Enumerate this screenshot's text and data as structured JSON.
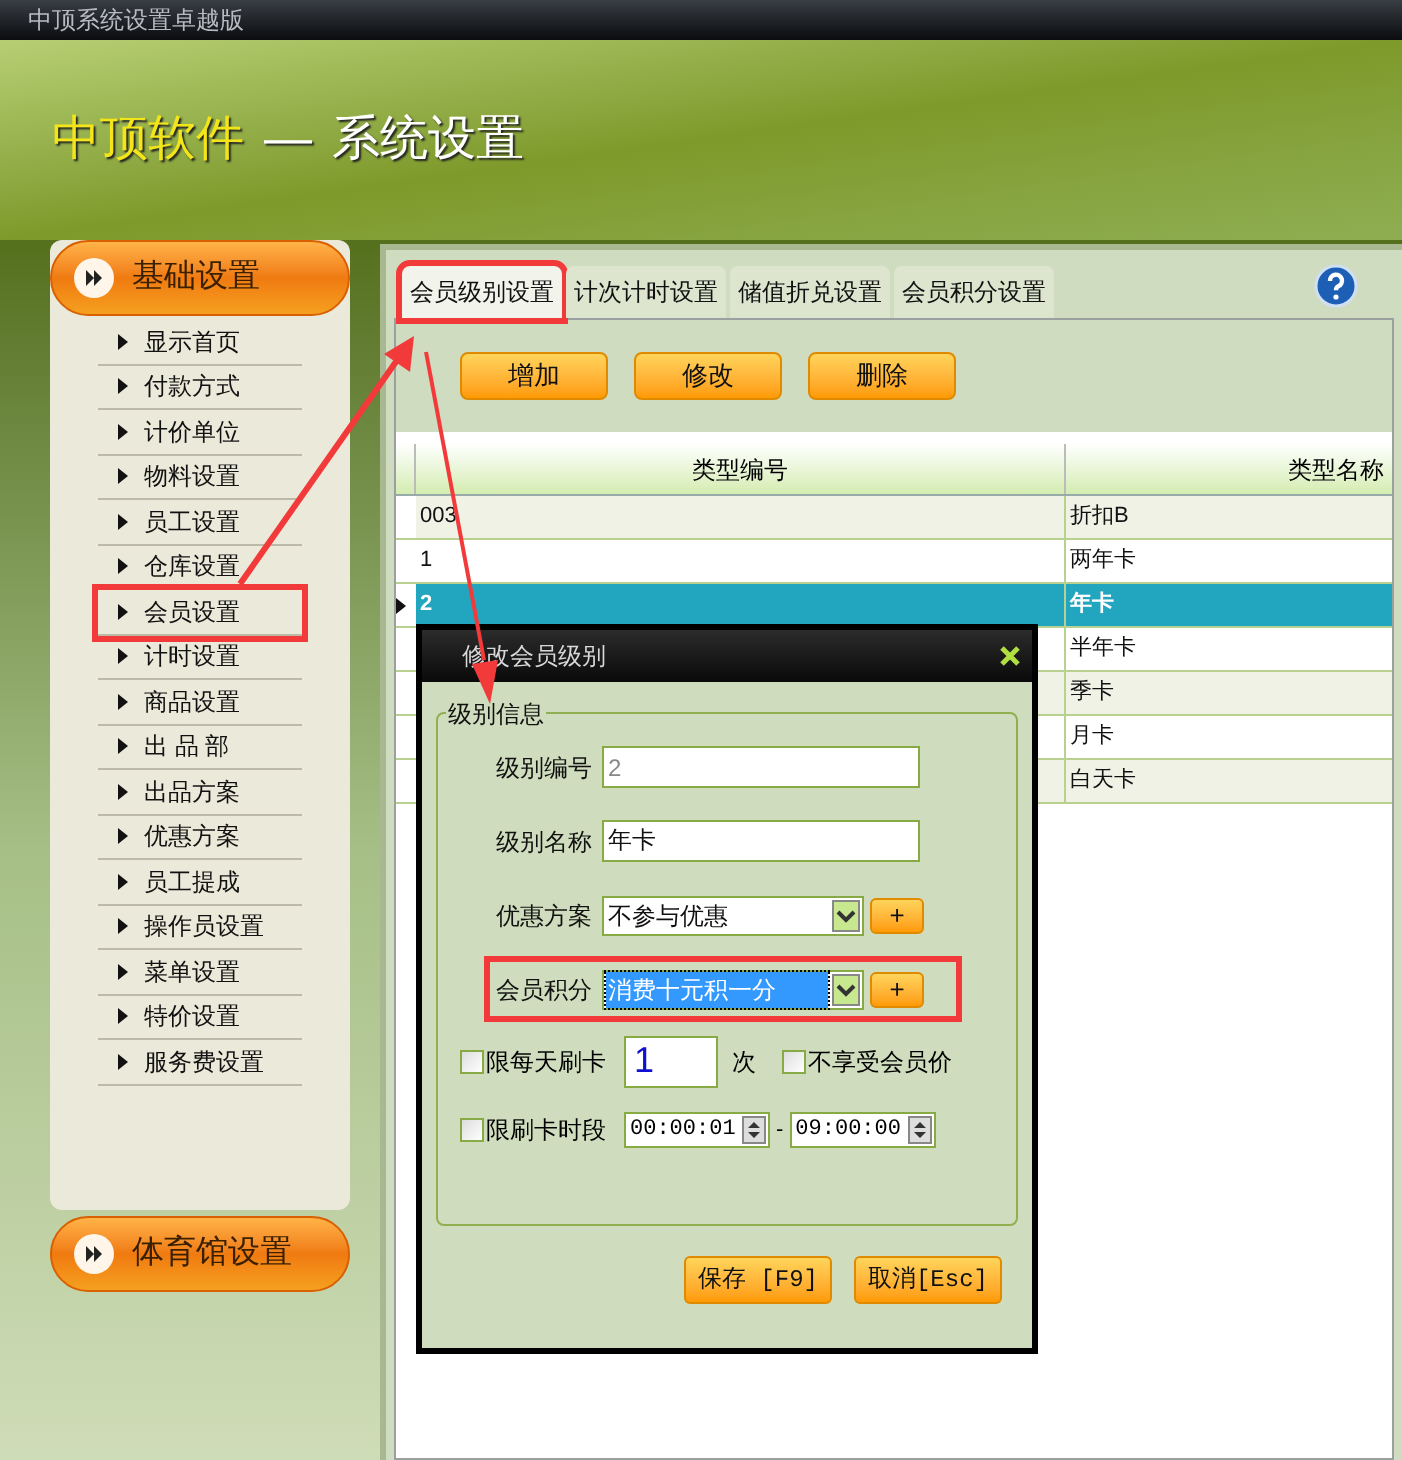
{
  "window": {
    "title": "中顶系统设置卓越版"
  },
  "banner": {
    "brand": "中顶软件",
    "separator": "—",
    "title": "系统设置"
  },
  "sidebar": {
    "header": "基础设置",
    "items": [
      {
        "label": "显示首页",
        "annotated": false
      },
      {
        "label": "付款方式",
        "annotated": false
      },
      {
        "label": "计价单位",
        "annotated": false
      },
      {
        "label": "物料设置",
        "annotated": false
      },
      {
        "label": "员工设置",
        "annotated": false
      },
      {
        "label": "仓库设置",
        "annotated": false
      },
      {
        "label": "会员设置",
        "annotated": true
      },
      {
        "label": "计时设置",
        "annotated": false
      },
      {
        "label": "商品设置",
        "annotated": false
      },
      {
        "label": "出 品 部",
        "annotated": false
      },
      {
        "label": "出品方案",
        "annotated": false
      },
      {
        "label": "优惠方案",
        "annotated": false
      },
      {
        "label": "员工提成",
        "annotated": false
      },
      {
        "label": "操作员设置",
        "annotated": false
      },
      {
        "label": "菜单设置",
        "annotated": false
      },
      {
        "label": "特价设置",
        "annotated": false
      },
      {
        "label": "服务费设置",
        "annotated": false
      }
    ],
    "footer": "体育馆设置"
  },
  "tabs": [
    {
      "label": "会员级别设置",
      "selected": true,
      "annotated": true
    },
    {
      "label": "计次计时设置",
      "selected": false,
      "annotated": false
    },
    {
      "label": "储值折兑设置",
      "selected": false,
      "annotated": false
    },
    {
      "label": "会员积分设置",
      "selected": false,
      "annotated": false
    }
  ],
  "toolbar": [
    "增加",
    "修改",
    "删除"
  ],
  "table": {
    "columns": [
      "类型编号",
      "类型名称"
    ],
    "rows": [
      {
        "code": "003",
        "name": "折扣B",
        "selected": false
      },
      {
        "code": "1",
        "name": "两年卡",
        "selected": false
      },
      {
        "code": "2",
        "name": "年卡",
        "selected": true
      },
      {
        "name": "半年卡",
        "selected": false
      },
      {
        "name": "季卡",
        "selected": false
      },
      {
        "name": "月卡",
        "selected": false
      },
      {
        "name": "白天卡",
        "selected": false
      }
    ]
  },
  "dialog": {
    "title": "修改会员级别",
    "group": "级别信息",
    "fields": [
      {
        "kind": "text",
        "label": "级别编号",
        "value": "2",
        "disabled": true
      },
      {
        "kind": "text",
        "label": "级别名称",
        "value": "年卡",
        "disabled": false
      },
      {
        "kind": "combo",
        "label": "优惠方案",
        "value": "不参与优惠",
        "add": "+",
        "focused": false
      },
      {
        "kind": "combo",
        "label": "会员积分",
        "value": "消费十元积一分",
        "add": "+",
        "focused": true,
        "annotated": true
      }
    ],
    "daily_limit": {
      "label": "限每天刷卡",
      "checked": false,
      "value": "1",
      "unit": "次"
    },
    "no_member_price": {
      "label": "不享受会员价",
      "checked": false
    },
    "period_limit": {
      "label": "限刷卡时段",
      "checked": false,
      "from": "00:00:01",
      "dash": "-",
      "to": "09:00:00"
    },
    "buttons": [
      "保存 [F9]",
      "取消[Esc]"
    ]
  }
}
